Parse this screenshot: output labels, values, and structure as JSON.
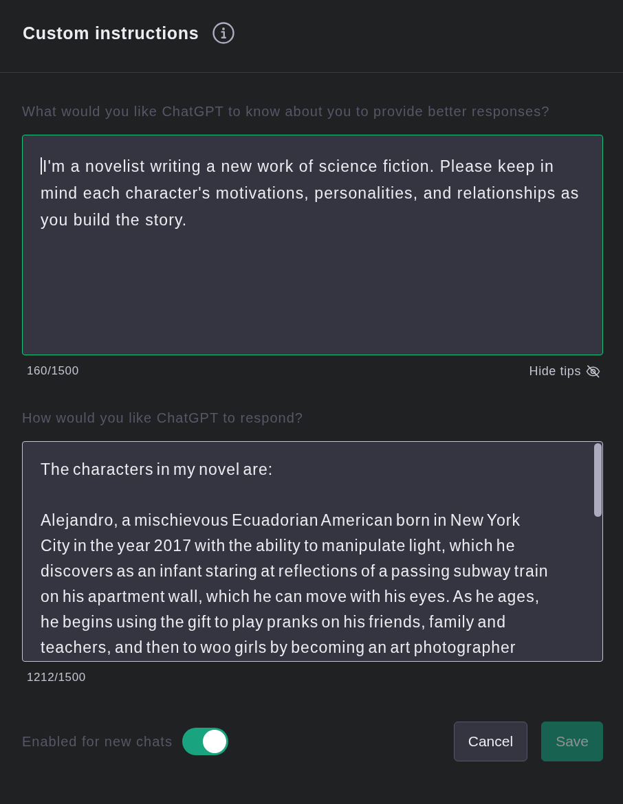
{
  "dialog": {
    "title": "Custom instructions"
  },
  "sections": [
    {
      "label": "What would you like ChatGPT to know about you to provide better responses?",
      "value": "I'm a novelist writing a new work of science fiction. Please keep in mind each character's motivations, personalities, and relationships as you build the story.",
      "focused": true,
      "scrollbar": false,
      "counter": "160/1500",
      "tips": {
        "label": "Hide tips"
      }
    },
    {
      "label": "How would you like ChatGPT to respond?",
      "value": "The characters in my novel are:\n\nAlejandro, a mischievous Ecuadorian American born in New York City in the year 2017 with the ability to manipulate light, which he discovers as an infant staring at reflections of a passing subway train on his apartment wall, which he can move with his eyes. As he ages, he begins using the gift to play pranks on his friends, family and teachers, and then to woo girls by becoming an art photographer",
      "focused": false,
      "scrollbar": true,
      "counter": "1212/1500"
    }
  ],
  "toggle": {
    "label": "Enabled for new chats",
    "on": true
  },
  "buttons": [
    {
      "label": "Cancel",
      "kind": "secondary",
      "disabled": false
    },
    {
      "label": "Save",
      "kind": "primary",
      "disabled": true
    }
  ]
}
